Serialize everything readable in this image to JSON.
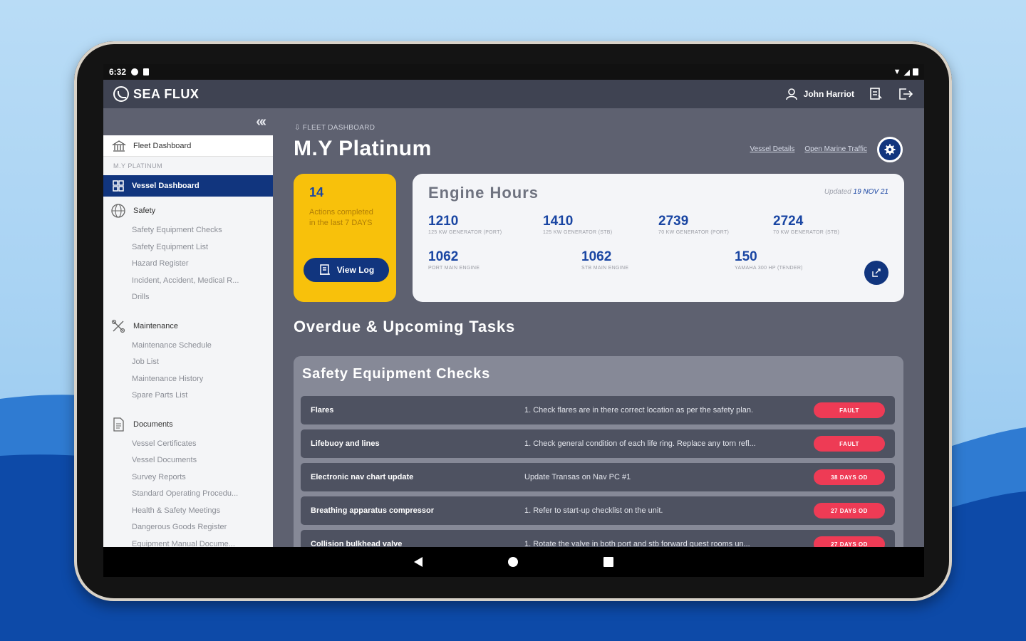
{
  "statusbar": {
    "time": "6:32"
  },
  "app": {
    "logo_text": "SEA FLUX",
    "user_name": "John Harriot"
  },
  "sidebar": {
    "collapse_glyph": "«‹",
    "fleet_label": "Fleet Dashboard",
    "vessel_label": "M.Y PLATINUM",
    "active_label": "Vessel Dashboard",
    "sections": [
      {
        "label": "Safety",
        "icon": "globe-icon",
        "items": [
          "Safety Equipment Checks",
          "Safety Equipment List",
          "Hazard Register",
          "Incident, Accident, Medical R...",
          "Drills"
        ]
      },
      {
        "label": "Maintenance",
        "icon": "tools-icon",
        "items": [
          "Maintenance Schedule",
          "Job List",
          "Maintenance History",
          "Spare Parts List"
        ]
      },
      {
        "label": "Documents",
        "icon": "document-icon",
        "items": [
          "Vessel Certificates",
          "Vessel Documents",
          "Survey Reports",
          "Standard Operating Procedu...",
          "Health & Safety Meetings",
          "Dangerous Goods Register",
          "Equipment Manual Docume..."
        ]
      }
    ]
  },
  "main": {
    "breadcrumb": "⇩ FLEET DASHBOARD",
    "title": "M.Y Platinum",
    "links": [
      "Vessel Details",
      "Open Marine Traffic"
    ],
    "actions": {
      "count": "14",
      "text": "Actions completed in the last 7 DAYS",
      "button": "View Log"
    },
    "engine": {
      "title": "Engine Hours",
      "updated_prefix": "Updated",
      "updated_date": "19 NOV 21",
      "hours": [
        {
          "value": "1210",
          "label": "125 KW GENERATOR (PORT)"
        },
        {
          "value": "1410",
          "label": "125 KW GENERATOR (STB)"
        },
        {
          "value": "2739",
          "label": "70 KW GENERATOR (PORT)"
        },
        {
          "value": "2724",
          "label": "70 KW GENERATOR (STB)"
        },
        {
          "value": "1062",
          "label": "PORT MAIN ENGINE"
        },
        {
          "value": "1062",
          "label": "STB MAIN ENGINE"
        },
        {
          "value": "150",
          "label": "YAMAHA 300 HP (TENDER)"
        }
      ]
    },
    "section_title": "Overdue & Upcoming Tasks",
    "tasks_title": "Safety Equipment Checks",
    "tasks": [
      {
        "name": "Flares",
        "desc": "1. Check flares are in there correct location as per the safety plan.",
        "status": "FAULT"
      },
      {
        "name": "Lifebuoy and lines",
        "desc": "1. Check general condition of each life ring. Replace any torn refl...",
        "status": "FAULT"
      },
      {
        "name": "Electronic nav chart update",
        "desc": "Update Transas on Nav PC #1",
        "status": "38 DAYS OD"
      },
      {
        "name": "Breathing apparatus compressor",
        "desc": "1. Refer to start-up checklist on the unit.",
        "status": "27 DAYS OD"
      },
      {
        "name": "Collision bulkhead valve",
        "desc": "1. Rotate the valve in both port and stb forward guest rooms un...",
        "status": "27 DAYS OD"
      }
    ]
  },
  "colors": {
    "accent": "#11357e",
    "card_yellow": "#f8c10b",
    "fault_red": "#ee3b55"
  }
}
